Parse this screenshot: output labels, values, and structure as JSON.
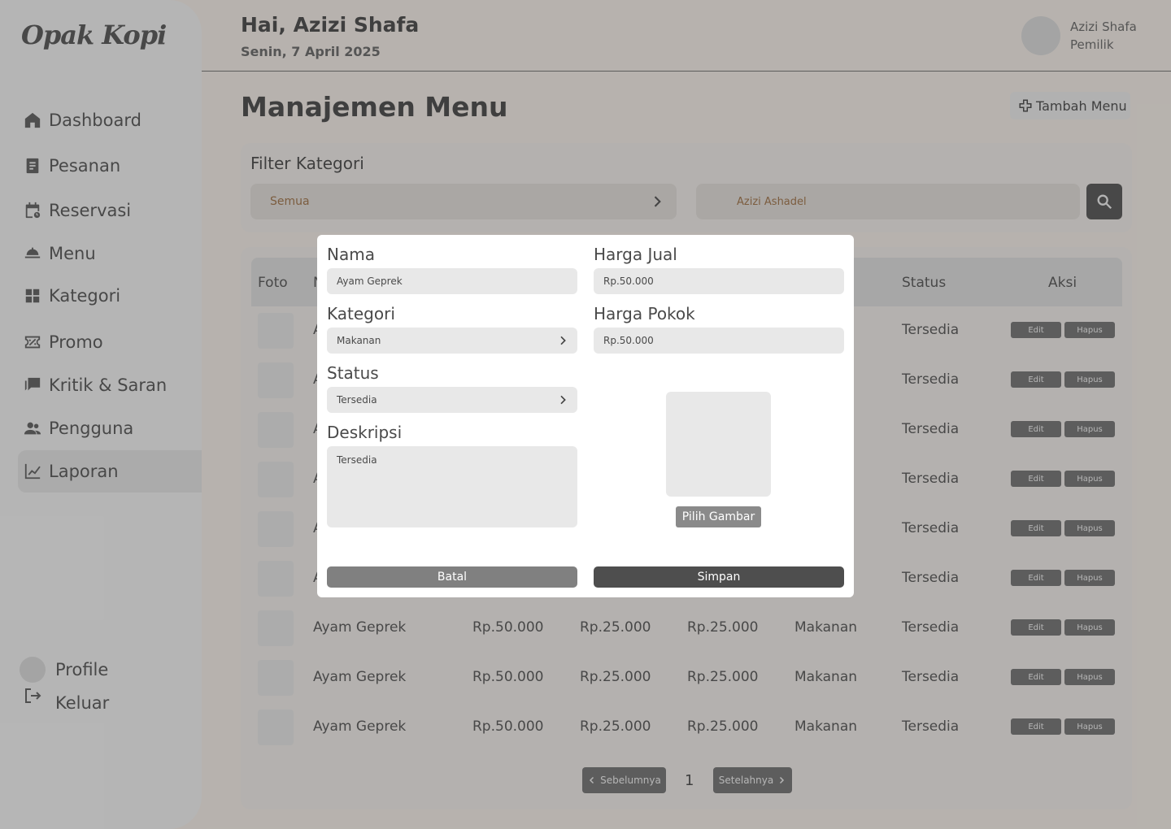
{
  "app": {
    "logo": "Opak Kopi"
  },
  "sidebar": {
    "items": [
      {
        "label": "Dashboard",
        "icon": "home-icon"
      },
      {
        "label": "Pesanan",
        "icon": "receipt-icon"
      },
      {
        "label": "Reservasi",
        "icon": "calendar-icon"
      },
      {
        "label": "Menu",
        "icon": "cloche-icon"
      },
      {
        "label": "Kategori",
        "icon": "grid-icon"
      },
      {
        "label": "Promo",
        "icon": "ticket-icon"
      },
      {
        "label": "Kritik & Saran",
        "icon": "chat-icon"
      },
      {
        "label": "Pengguna",
        "icon": "users-icon"
      },
      {
        "label": "Laporan",
        "icon": "chart-icon"
      }
    ],
    "active": "Laporan",
    "profile_label": "Profile",
    "logout_label": "Keluar"
  },
  "header": {
    "greeting": "Hai, Azizi Shafa",
    "date": "Senin, 7 April 2025",
    "user_name": "Azizi Shafa",
    "user_role": "Pemilik"
  },
  "main": {
    "title": "Manajemen Menu",
    "add_button": "Tambah Menu",
    "filter": {
      "title": "Filter Kategori",
      "selected": "Semua",
      "search_value": "Azizi Ashadel"
    },
    "table": {
      "headers": [
        "Foto",
        "N",
        "Status",
        "Aksi"
      ],
      "visible_cells": [
        {
          "status": "Tersedia"
        },
        {
          "status": "Tersedia"
        },
        {
          "status": "Tersedia"
        },
        {
          "status": "Tersedia"
        },
        {
          "status": "Tersedia"
        },
        {
          "status": "Tersedia"
        },
        {
          "name": "Ayam Geprek",
          "c2": "Rp.50.000",
          "c3": "Rp.25.000",
          "c4": "Rp.25.000",
          "category": "Makanan",
          "status": "Tersedia"
        },
        {
          "name": "Ayam Geprek",
          "c2": "Rp.50.000",
          "c3": "Rp.25.000",
          "c4": "Rp.25.000",
          "category": "Makanan",
          "status": "Tersedia"
        },
        {
          "name": "Ayam Geprek",
          "c2": "Rp.50.000",
          "c3": "Rp.25.000",
          "c4": "Rp.25.000",
          "category": "Makanan",
          "status": "Tersedia"
        }
      ],
      "edit_label": "Edit",
      "delete_label": "Hapus",
      "partial_first_char": "A"
    },
    "pagination": {
      "prev": "Sebelumnya",
      "page": "1",
      "next": "Setelahnya"
    }
  },
  "modal": {
    "name_label": "Nama",
    "name_value": "Ayam Geprek",
    "sell_label": "Harga Jual",
    "sell_value": "Rp.50.000",
    "category_label": "Kategori",
    "category_value": "Makanan",
    "cost_label": "Harga Pokok",
    "cost_value": "Rp.50.000",
    "status_label": "Status",
    "status_value": "Tersedia",
    "desc_label": "Deskripsi",
    "desc_value": "Tersedia",
    "pick_image": "Pilih Gambar",
    "cancel": "Batal",
    "save": "Simpan"
  }
}
